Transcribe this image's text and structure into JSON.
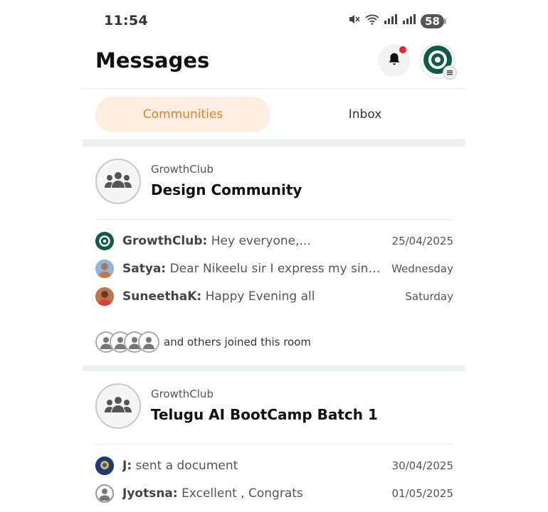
{
  "status_bar": {
    "time": "11:54",
    "battery": "58",
    "icons": [
      "mute-icon",
      "wifi-icon",
      "signal-icon",
      "signal-icon"
    ]
  },
  "header": {
    "title": "Messages",
    "notification_dot_color": "#e5262f"
  },
  "tabs": [
    {
      "label": "Communities",
      "active": true
    },
    {
      "label": "Inbox",
      "active": false
    }
  ],
  "colors": {
    "accent": "#e87d2a",
    "accent_bg": "#fdeee2",
    "brand_green": "#0f5c45"
  },
  "communities": [
    {
      "org": "GrowthClub",
      "name": "Design Community",
      "messages": [
        {
          "sender": "GrowthClub:",
          "text": " Hey everyone,...",
          "date": "25/04/2025",
          "avatar": "growthclub-logo-icon"
        },
        {
          "sender": "Satya:",
          "text": " Dear Nikeelu sir I express my sincer...",
          "date": "Wednesday",
          "avatar": "user-photo-icon"
        },
        {
          "sender": "SuneethaK:",
          "text": " Happy Evening all",
          "date": "Saturday",
          "avatar": "user-photo-icon"
        }
      ],
      "joined_text": "and others joined this room"
    },
    {
      "org": "GrowthClub",
      "name": "Telugu AI BootCamp Batch 1",
      "messages": [
        {
          "sender": "J:",
          "text": " sent a document",
          "date": "30/04/2025",
          "avatar": "user-photo-icon"
        },
        {
          "sender": "Jyotsna:",
          "text": " Excellent , Congrats",
          "date": "01/05/2025",
          "avatar": "default-user-icon"
        }
      ]
    }
  ]
}
